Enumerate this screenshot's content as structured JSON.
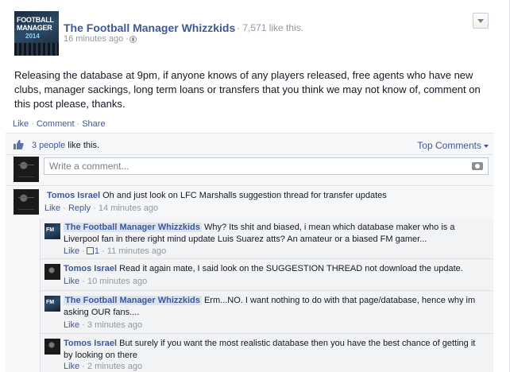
{
  "post": {
    "page_name": "The Football Manager Whizzkids",
    "page_likes": "7,571 like this.",
    "timestamp": "16 minutes ago",
    "logo_line1": "FOOTBALL",
    "logo_line2": "MANAGER",
    "logo_line3": "2014",
    "body": "Releasing the database at 9pm, if anyone knows of any players released, free agents who have new clubs, manager sackings, long term loans or transfers that you think we may not know of, comment on this post please, thanks."
  },
  "actions": {
    "like": "Like",
    "comment": "Comment",
    "share": "Share"
  },
  "ufi": {
    "likers": "3 people",
    "likers_suffix": " like this.",
    "sort": "Top Comments",
    "comment_placeholder": "Write a comment..."
  },
  "comments": [
    {
      "author": "Tomos Israel",
      "text": "Oh and just look on LFC Marshalls suggestion thread for transfer updates",
      "like": "Like",
      "reply": "Reply",
      "time": "14 minutes ago"
    }
  ],
  "replies": [
    {
      "author": "The Football Manager Whizzkids",
      "text": "Why? Its shit and biased, i mean which database maker who is a Liverpool fan in there right mind update Luis Suarez atts? An amateur or a biased FM gamer...",
      "like": "Like",
      "like_count": "1",
      "time": "11 minutes ago"
    },
    {
      "author": "Tomos Israel",
      "text": "Read it again mate, I said look on the SUGGESTION THREAD not download the update.",
      "like": "Like",
      "time": "10 minutes ago"
    },
    {
      "author": "The Football Manager Whizzkids",
      "text": "Erm...NO. I want nothing to do with that page/database, hence why im asking OUR fans....",
      "like": "Like",
      "time": "3 minutes ago"
    },
    {
      "author": "Tomos Israel",
      "text": "But surely if you want the most realistic database then you have the best chance of getting it by looking on there",
      "like": "Like",
      "time": "2 minutes ago"
    }
  ],
  "separators": {
    "dot": "·"
  }
}
